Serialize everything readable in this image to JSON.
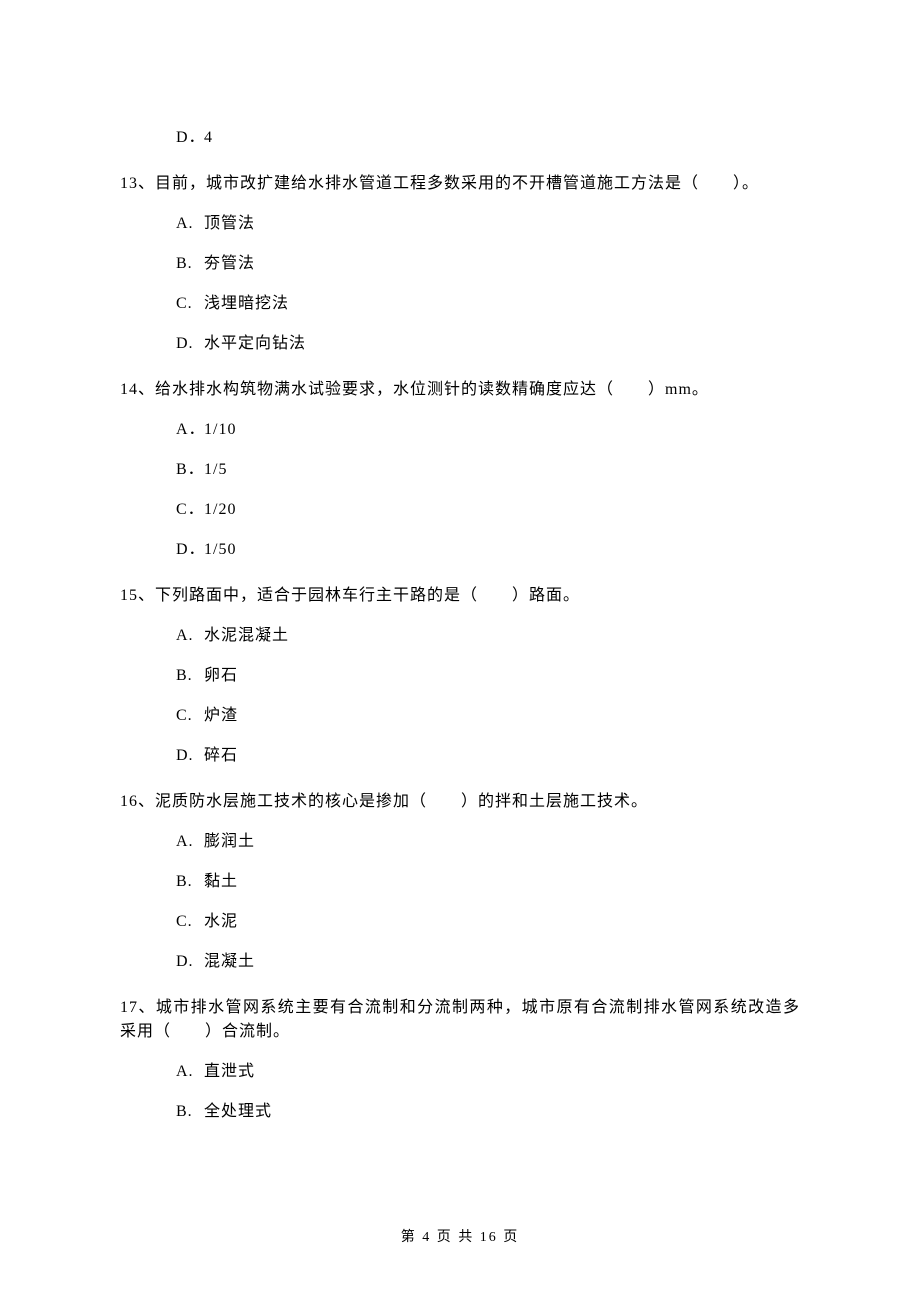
{
  "orphan_option": {
    "letter": "D．",
    "text": "4"
  },
  "questions": [
    {
      "num": "13、",
      "text": "目前，城市改扩建给水排水管道工程多数采用的不开槽管道施工方法是（　　）。",
      "options": [
        {
          "letter": "A.",
          "text": "顶管法"
        },
        {
          "letter": "B.",
          "text": "夯管法"
        },
        {
          "letter": "C.",
          "text": "浅埋暗挖法"
        },
        {
          "letter": "D.",
          "text": "水平定向钻法"
        }
      ]
    },
    {
      "num": "14、",
      "text": "给水排水构筑物满水试验要求，水位测针的读数精确度应达（　　）mm。",
      "options": [
        {
          "letter": "A．",
          "text": "1/10"
        },
        {
          "letter": "B．",
          "text": "1/5"
        },
        {
          "letter": "C．",
          "text": "1/20"
        },
        {
          "letter": "D．",
          "text": "1/50"
        }
      ]
    },
    {
      "num": "15、",
      "text": "下列路面中，适合于园林车行主干路的是（　　）路面。",
      "options": [
        {
          "letter": "A.",
          "text": "水泥混凝土"
        },
        {
          "letter": "B.",
          "text": "卵石"
        },
        {
          "letter": "C.",
          "text": "炉渣"
        },
        {
          "letter": "D.",
          "text": "碎石"
        }
      ]
    },
    {
      "num": "16、",
      "text": "泥质防水层施工技术的核心是掺加（　　）的拌和土层施工技术。",
      "options": [
        {
          "letter": "A.",
          "text": "膨润土"
        },
        {
          "letter": "B.",
          "text": "黏土"
        },
        {
          "letter": "C.",
          "text": "水泥"
        },
        {
          "letter": "D.",
          "text": "混凝土"
        }
      ]
    },
    {
      "num": "17、",
      "text": "城市排水管网系统主要有合流制和分流制两种，城市原有合流制排水管网系统改造多采用（　　）合流制。",
      "options": [
        {
          "letter": "A.",
          "text": "直泄式"
        },
        {
          "letter": "B.",
          "text": "全处理式"
        }
      ]
    }
  ],
  "footer": "第 4 页 共 16 页"
}
